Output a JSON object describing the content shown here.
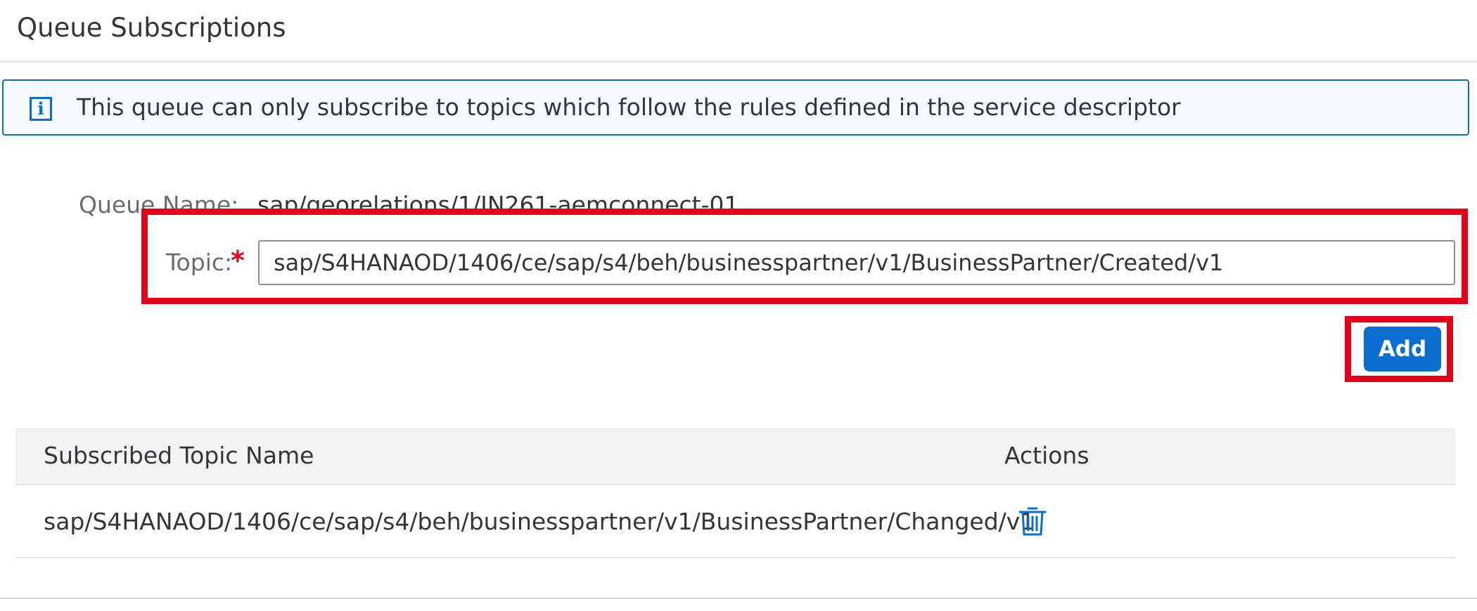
{
  "header": {
    "title": "Queue Subscriptions"
  },
  "info_strip": {
    "icon": "info-icon",
    "icon_glyph": "i",
    "text": "This queue can only subscribe to topics which follow the rules defined in the service descriptor"
  },
  "form": {
    "queue_name_label": "Queue Name:",
    "queue_name_value": "sap/georelations/1/IN261-aemconnect-01",
    "topic_label": "Topic:",
    "topic_required_marker": "*",
    "topic_value": "sap/S4HANAOD/1406/ce/sap/s4/beh/businesspartner/v1/BusinessPartner/Created/v1",
    "add_label": "Add"
  },
  "table": {
    "columns": [
      "Subscribed Topic Name",
      "Actions"
    ],
    "rows": [
      {
        "topic": "sap/S4HANAOD/1406/ce/sap/s4/beh/businesspartner/v1/BusinessPartner/Changed/v1",
        "action_icon": "trash-icon"
      }
    ]
  },
  "colors": {
    "accent": "#0a6ed1",
    "highlight": "#e2001a",
    "text": "#32363a",
    "label": "#6a6d70"
  }
}
